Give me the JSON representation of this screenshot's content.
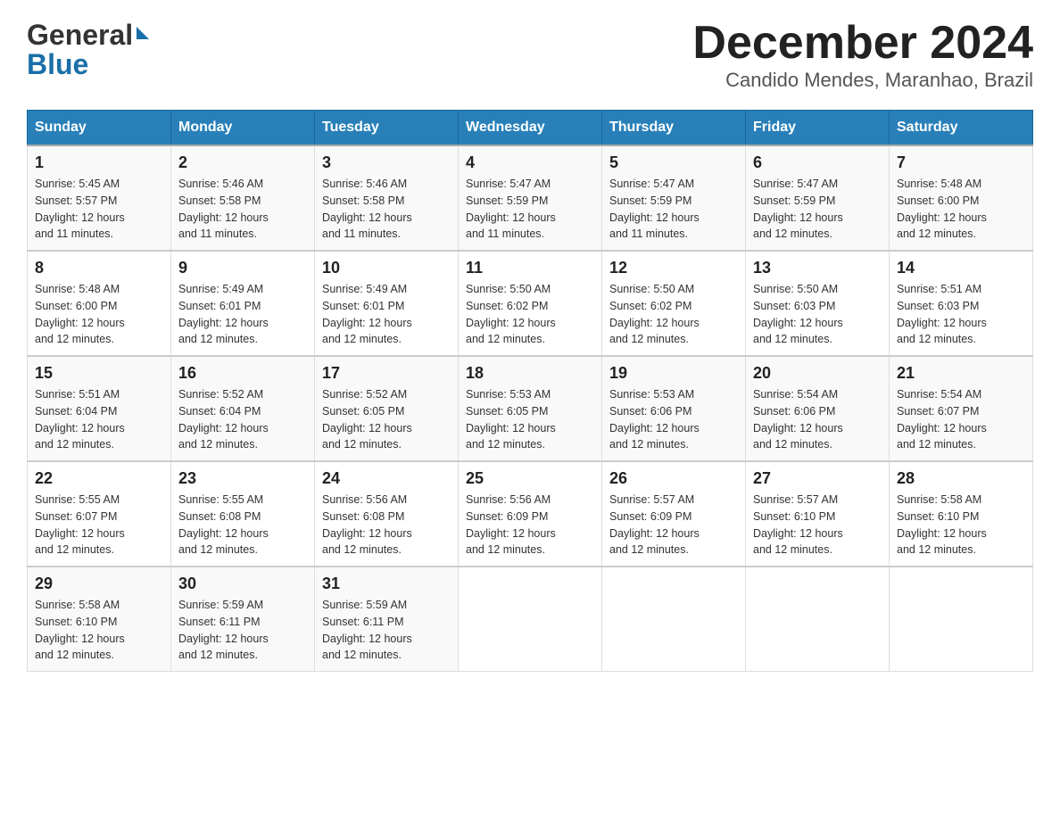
{
  "logo": {
    "general": "General",
    "blue": "Blue",
    "arrow": "▶"
  },
  "title": {
    "month_year": "December 2024",
    "location": "Candido Mendes, Maranhao, Brazil"
  },
  "headers": [
    "Sunday",
    "Monday",
    "Tuesday",
    "Wednesday",
    "Thursday",
    "Friday",
    "Saturday"
  ],
  "weeks": [
    [
      {
        "day": "1",
        "sunrise": "5:45 AM",
        "sunset": "5:57 PM",
        "daylight": "12 hours and 11 minutes."
      },
      {
        "day": "2",
        "sunrise": "5:46 AM",
        "sunset": "5:58 PM",
        "daylight": "12 hours and 11 minutes."
      },
      {
        "day": "3",
        "sunrise": "5:46 AM",
        "sunset": "5:58 PM",
        "daylight": "12 hours and 11 minutes."
      },
      {
        "day": "4",
        "sunrise": "5:47 AM",
        "sunset": "5:59 PM",
        "daylight": "12 hours and 11 minutes."
      },
      {
        "day": "5",
        "sunrise": "5:47 AM",
        "sunset": "5:59 PM",
        "daylight": "12 hours and 11 minutes."
      },
      {
        "day": "6",
        "sunrise": "5:47 AM",
        "sunset": "5:59 PM",
        "daylight": "12 hours and 12 minutes."
      },
      {
        "day": "7",
        "sunrise": "5:48 AM",
        "sunset": "6:00 PM",
        "daylight": "12 hours and 12 minutes."
      }
    ],
    [
      {
        "day": "8",
        "sunrise": "5:48 AM",
        "sunset": "6:00 PM",
        "daylight": "12 hours and 12 minutes."
      },
      {
        "day": "9",
        "sunrise": "5:49 AM",
        "sunset": "6:01 PM",
        "daylight": "12 hours and 12 minutes."
      },
      {
        "day": "10",
        "sunrise": "5:49 AM",
        "sunset": "6:01 PM",
        "daylight": "12 hours and 12 minutes."
      },
      {
        "day": "11",
        "sunrise": "5:50 AM",
        "sunset": "6:02 PM",
        "daylight": "12 hours and 12 minutes."
      },
      {
        "day": "12",
        "sunrise": "5:50 AM",
        "sunset": "6:02 PM",
        "daylight": "12 hours and 12 minutes."
      },
      {
        "day": "13",
        "sunrise": "5:50 AM",
        "sunset": "6:03 PM",
        "daylight": "12 hours and 12 minutes."
      },
      {
        "day": "14",
        "sunrise": "5:51 AM",
        "sunset": "6:03 PM",
        "daylight": "12 hours and 12 minutes."
      }
    ],
    [
      {
        "day": "15",
        "sunrise": "5:51 AM",
        "sunset": "6:04 PM",
        "daylight": "12 hours and 12 minutes."
      },
      {
        "day": "16",
        "sunrise": "5:52 AM",
        "sunset": "6:04 PM",
        "daylight": "12 hours and 12 minutes."
      },
      {
        "day": "17",
        "sunrise": "5:52 AM",
        "sunset": "6:05 PM",
        "daylight": "12 hours and 12 minutes."
      },
      {
        "day": "18",
        "sunrise": "5:53 AM",
        "sunset": "6:05 PM",
        "daylight": "12 hours and 12 minutes."
      },
      {
        "day": "19",
        "sunrise": "5:53 AM",
        "sunset": "6:06 PM",
        "daylight": "12 hours and 12 minutes."
      },
      {
        "day": "20",
        "sunrise": "5:54 AM",
        "sunset": "6:06 PM",
        "daylight": "12 hours and 12 minutes."
      },
      {
        "day": "21",
        "sunrise": "5:54 AM",
        "sunset": "6:07 PM",
        "daylight": "12 hours and 12 minutes."
      }
    ],
    [
      {
        "day": "22",
        "sunrise": "5:55 AM",
        "sunset": "6:07 PM",
        "daylight": "12 hours and 12 minutes."
      },
      {
        "day": "23",
        "sunrise": "5:55 AM",
        "sunset": "6:08 PM",
        "daylight": "12 hours and 12 minutes."
      },
      {
        "day": "24",
        "sunrise": "5:56 AM",
        "sunset": "6:08 PM",
        "daylight": "12 hours and 12 minutes."
      },
      {
        "day": "25",
        "sunrise": "5:56 AM",
        "sunset": "6:09 PM",
        "daylight": "12 hours and 12 minutes."
      },
      {
        "day": "26",
        "sunrise": "5:57 AM",
        "sunset": "6:09 PM",
        "daylight": "12 hours and 12 minutes."
      },
      {
        "day": "27",
        "sunrise": "5:57 AM",
        "sunset": "6:10 PM",
        "daylight": "12 hours and 12 minutes."
      },
      {
        "day": "28",
        "sunrise": "5:58 AM",
        "sunset": "6:10 PM",
        "daylight": "12 hours and 12 minutes."
      }
    ],
    [
      {
        "day": "29",
        "sunrise": "5:58 AM",
        "sunset": "6:10 PM",
        "daylight": "12 hours and 12 minutes."
      },
      {
        "day": "30",
        "sunrise": "5:59 AM",
        "sunset": "6:11 PM",
        "daylight": "12 hours and 12 minutes."
      },
      {
        "day": "31",
        "sunrise": "5:59 AM",
        "sunset": "6:11 PM",
        "daylight": "12 hours and 12 minutes."
      },
      null,
      null,
      null,
      null
    ]
  ],
  "labels": {
    "sunrise": "Sunrise:",
    "sunset": "Sunset:",
    "daylight": "Daylight:"
  }
}
